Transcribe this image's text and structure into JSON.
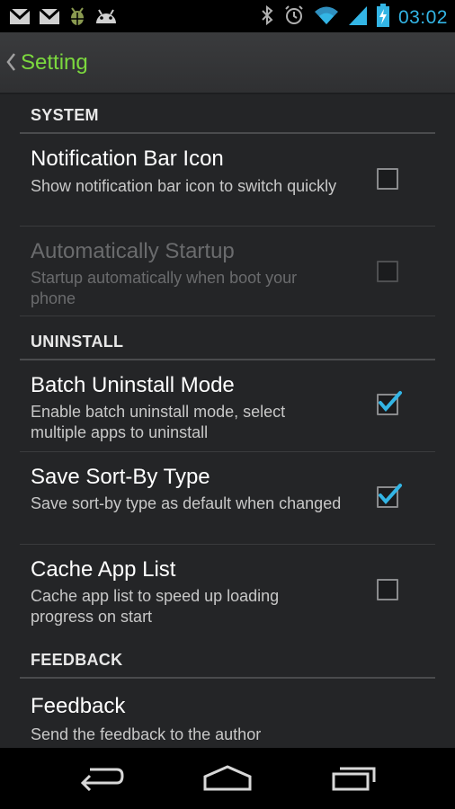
{
  "status_bar": {
    "time": "03:02",
    "left_icons": [
      "gmail-icon",
      "gmail-icon",
      "android-debug-icon",
      "android-icon"
    ],
    "right_icons": [
      "bluetooth-icon",
      "alarm-icon",
      "wifi-icon",
      "signal-icon",
      "battery-charging-icon"
    ],
    "accent": "#33b5e5"
  },
  "action_bar": {
    "title": "Setting",
    "title_color": "#7cd93e"
  },
  "sections": {
    "system": {
      "header": "SYSTEM",
      "notification": {
        "title": "Notification Bar Icon",
        "summary": "Show notification bar icon to switch quickly",
        "checked": false
      },
      "startup": {
        "title": "Automatically Startup",
        "summary": "Startup automatically when boot your phone",
        "checked": false,
        "enabled": false
      }
    },
    "uninstall": {
      "header": "UNINSTALL",
      "batch": {
        "title": "Batch Uninstall Mode",
        "summary": "Enable batch uninstall mode, select multiple apps to uninstall",
        "checked": true
      },
      "sort": {
        "title": "Save Sort-By Type",
        "summary": "Save sort-by type as default when changed",
        "checked": true
      },
      "cache": {
        "title": "Cache App List",
        "summary": "Cache app list to speed up loading progress on start",
        "checked": false
      }
    },
    "feedback": {
      "header": "FEEDBACK",
      "feedback": {
        "title": "Feedback",
        "summary": "Send the feedback to the author"
      }
    }
  },
  "nav_bar": {
    "buttons": [
      "back-icon",
      "home-icon",
      "recent-apps-icon"
    ]
  }
}
